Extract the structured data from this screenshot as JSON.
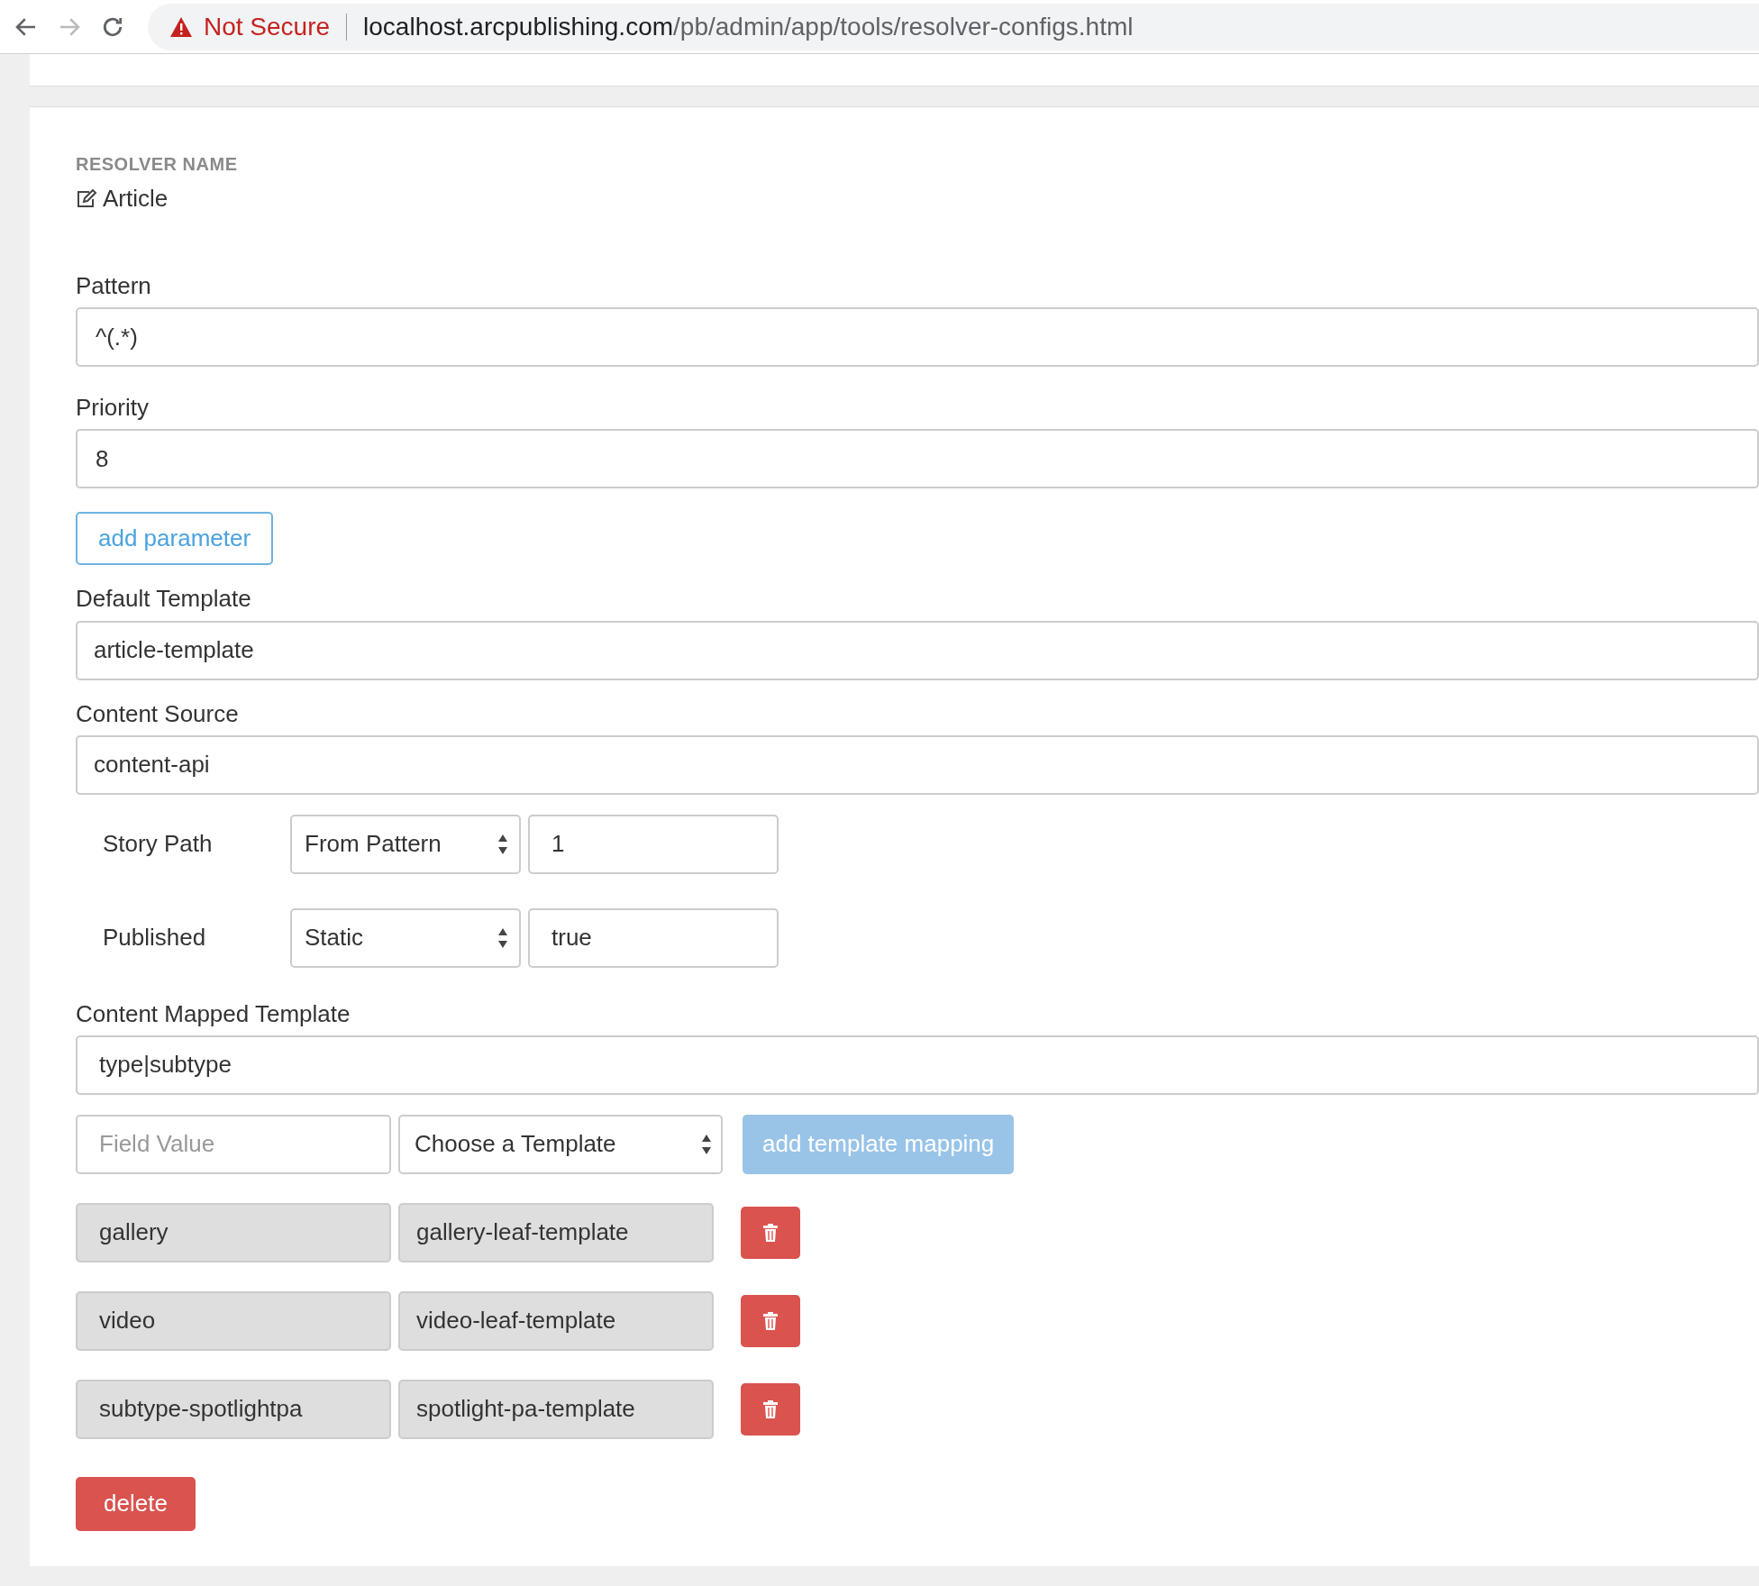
{
  "browser": {
    "security_label": "Not Secure",
    "url_host": "localhost.arcpublishing.com",
    "url_path": "/pb/admin/app/tools/resolver-configs.html"
  },
  "resolver_name": {
    "label": "RESOLVER NAME",
    "value": "Article"
  },
  "pattern": {
    "label": "Pattern",
    "value": "^(.*)"
  },
  "priority": {
    "label": "Priority",
    "value": "8"
  },
  "add_parameter_button": "add parameter",
  "default_template": {
    "label": "Default Template",
    "value": "article-template"
  },
  "content_source": {
    "label": "Content Source",
    "value": "content-api"
  },
  "content_params": [
    {
      "label": "Story Path",
      "source": "From Pattern",
      "value": "1"
    },
    {
      "label": "Published",
      "source": "Static",
      "value": "true"
    }
  ],
  "content_mapped_template": {
    "label": "Content Mapped Template",
    "value": "type|subtype"
  },
  "mapping_form": {
    "field_placeholder": "Field Value",
    "template_select": "Choose a Template",
    "add_button": "add template mapping",
    "disabled": true
  },
  "mappings": [
    {
      "field": "gallery",
      "template": "gallery-leaf-template"
    },
    {
      "field": "video",
      "template": "video-leaf-template"
    },
    {
      "field": "subtype-spotlightpa",
      "template": "spotlight-pa-template"
    }
  ],
  "delete_button": "delete"
}
